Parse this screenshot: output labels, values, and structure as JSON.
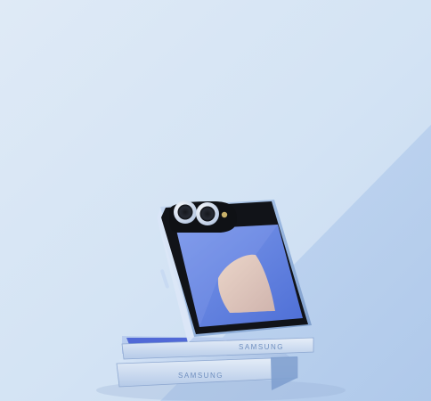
{
  "image": {
    "subject": "flip-phone-product-shot",
    "colors": {
      "background_light": "#d8e6f5",
      "background_mid": "#c7daef",
      "diagonal_panel": "#b8d0ee",
      "device_frame": "#9fbbe0",
      "device_frame_dark": "#7f9fcb",
      "screen_black": "#111318",
      "wallpaper_blue": "#5e7fe0",
      "wallpaper_peach": "#e5c5b4",
      "camera_ring": "#dce6f3",
      "flash": "#c9b16a"
    },
    "brand_marks": {
      "upper_hinge": "SAMSUNG",
      "lower_phone": "SAMSUNG"
    }
  }
}
